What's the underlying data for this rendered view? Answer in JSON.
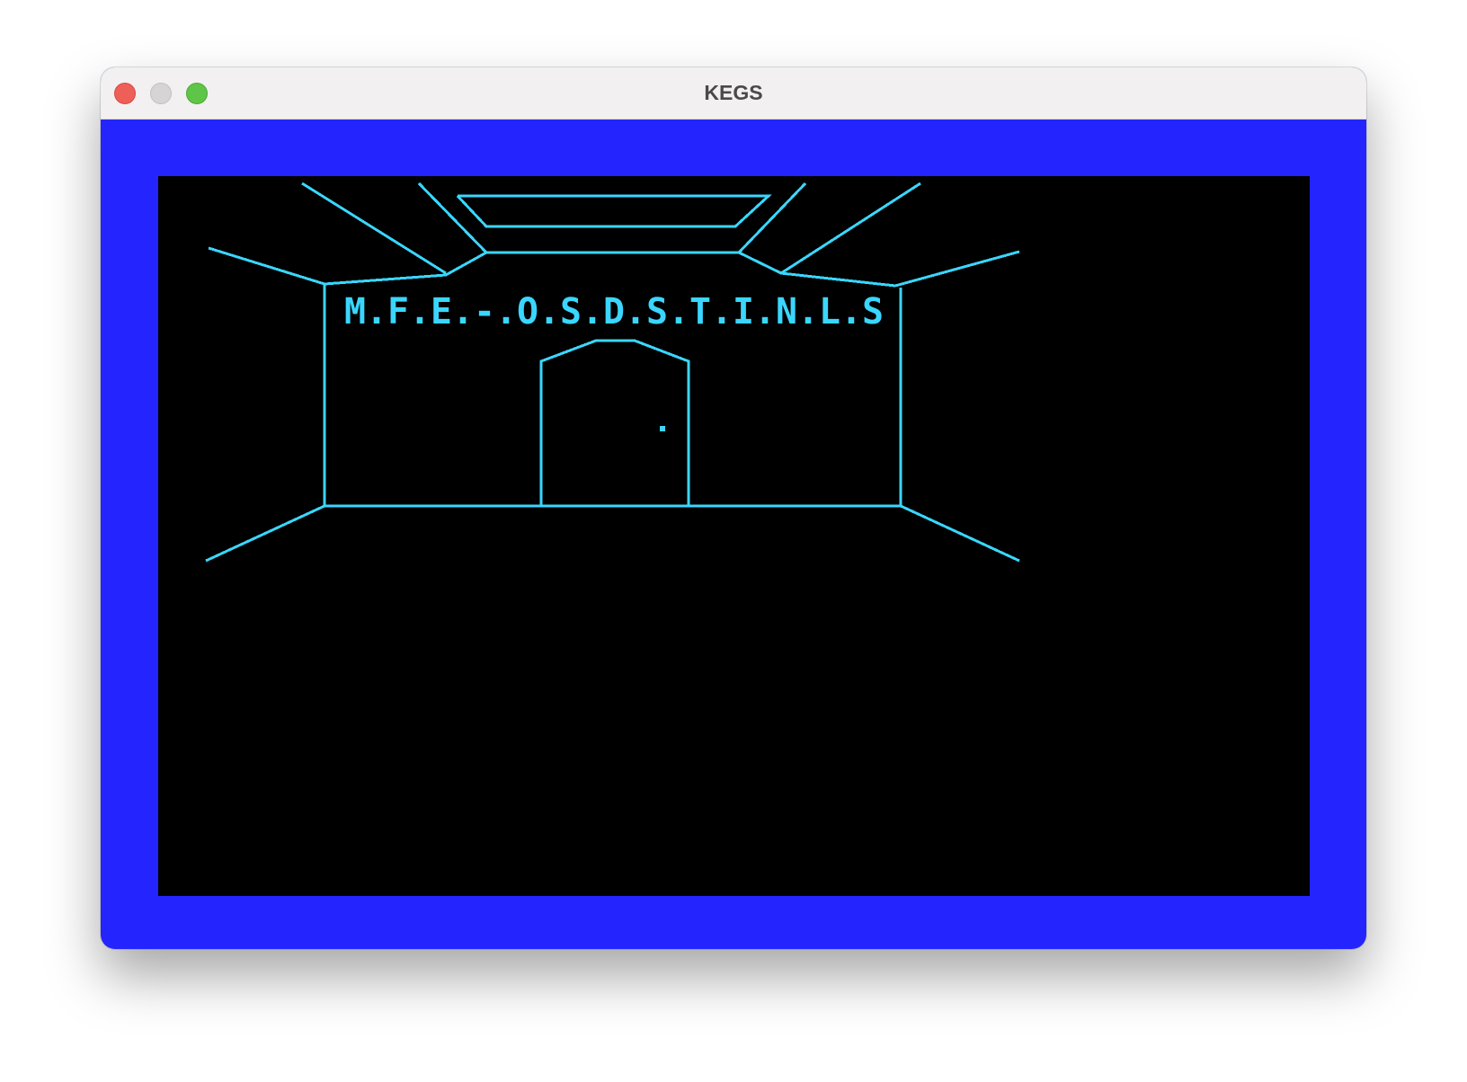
{
  "window": {
    "title": "KEGS"
  },
  "titlebar_buttons": {
    "close": "close-button",
    "minimize": "minimize-button",
    "zoom": "zoom-button"
  },
  "screen": {
    "border_color": "#2424ff",
    "background_color": "#000000",
    "line_color": "#3ad6ff",
    "sign_text": "M.F.E.-.O.S.D.S.T.I.N.L.S"
  }
}
